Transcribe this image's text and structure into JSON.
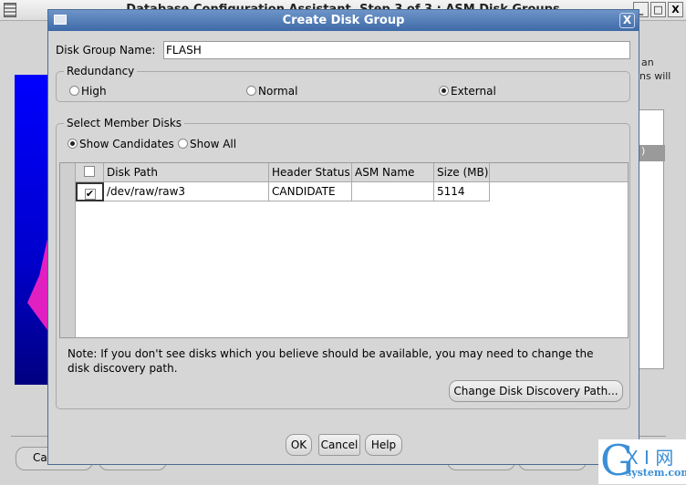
{
  "background_window": {
    "title": "Database Configuration Assistant, Step 3 of 3 : ASM Disk Groups",
    "text_fragment_1": "an",
    "text_fragment_2": "ns will",
    "list_header_fragment": ")",
    "button_fragment": "Ca"
  },
  "dialog": {
    "title": "Create Disk Group",
    "close_label": "X",
    "disk_group_name_label": "Disk Group Name:",
    "disk_group_name_value": "FLASH",
    "redundancy": {
      "label": "Redundancy",
      "options": [
        {
          "label": "High",
          "selected": false
        },
        {
          "label": "Normal",
          "selected": false
        },
        {
          "label": "External",
          "selected": true
        }
      ]
    },
    "member_disks": {
      "label": "Select Member Disks",
      "filters": [
        {
          "label": "Show Candidates",
          "selected": true
        },
        {
          "label": "Show All",
          "selected": false
        }
      ],
      "columns": [
        "Disk Path",
        "Header Status",
        "ASM Name",
        "Size (MB)"
      ],
      "rows": [
        {
          "checked": true,
          "disk_path": "/dev/raw/raw3",
          "header_status": "CANDIDATE",
          "asm_name": "",
          "size_mb": "5114"
        }
      ],
      "note": "Note: If you don't see disks which you believe should be available, you may need to change the disk discovery path.",
      "change_path_button": "Change Disk Discovery Path..."
    },
    "buttons": {
      "ok": "OK",
      "cancel": "Cancel",
      "help": "Help"
    }
  },
  "watermark": {
    "g": "G",
    "xi": "X I 网",
    "site": "system.com"
  },
  "colors": {
    "titlebar": "#3e6aa8",
    "dialog_bg": "#d6d6d6"
  }
}
